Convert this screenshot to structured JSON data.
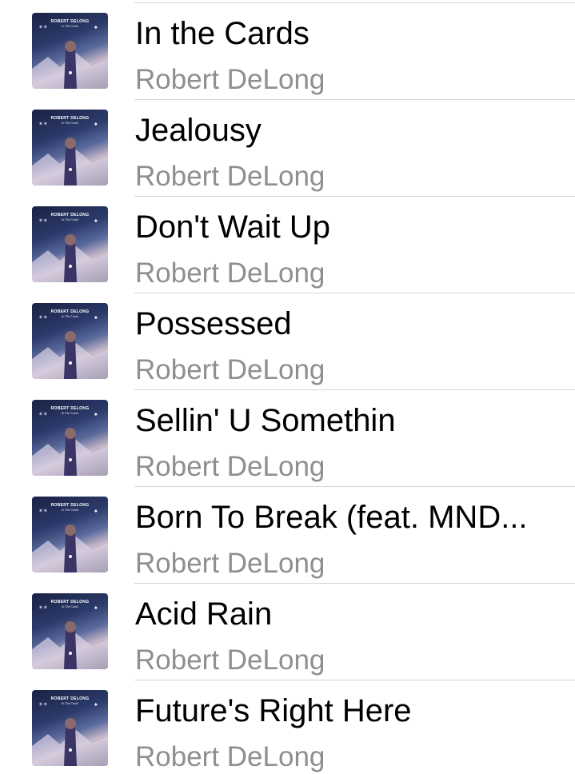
{
  "album_art": {
    "artist_text": "ROBERT DELONG",
    "album_text": "In The Cards",
    "icon": "album-cover"
  },
  "songs": [
    {
      "title": "In the Cards",
      "artist": "Robert DeLong"
    },
    {
      "title": "Jealousy",
      "artist": "Robert DeLong"
    },
    {
      "title": "Don't Wait Up",
      "artist": "Robert DeLong"
    },
    {
      "title": "Possessed",
      "artist": "Robert DeLong"
    },
    {
      "title": "Sellin' U Somethin",
      "artist": "Robert DeLong"
    },
    {
      "title": "Born To Break (feat. MND...",
      "artist": "Robert DeLong"
    },
    {
      "title": "Acid Rain",
      "artist": "Robert DeLong"
    },
    {
      "title": "Future's Right Here",
      "artist": "Robert DeLong"
    }
  ]
}
